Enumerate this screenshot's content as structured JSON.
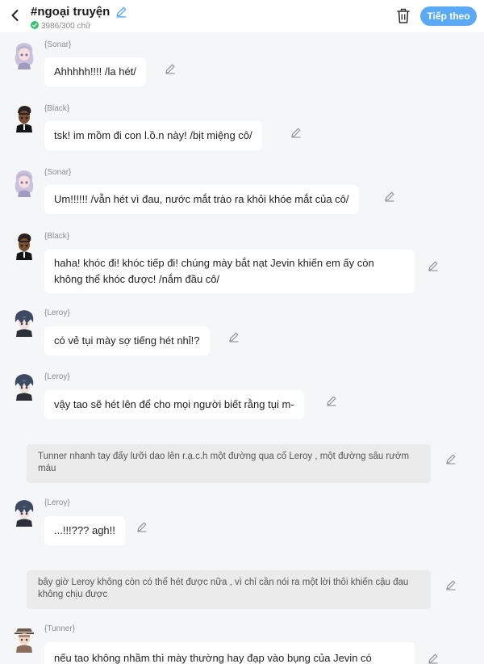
{
  "header": {
    "title": "#ngoại truyện",
    "count": "3986/300 chữ",
    "next_label": "Tiếp theo"
  },
  "colors": {
    "accent": "#5aa9f4",
    "check": "#34c26a",
    "background": "#f5f6f8"
  },
  "icons": [
    "back-arrow-icon",
    "pencil-icon",
    "check-icon",
    "trash-icon",
    "avatar-icon"
  ],
  "messages": [
    {
      "speaker": "{Sonar}",
      "text": "Ahhhhh!!!! /la hét/"
    },
    {
      "speaker": "{Black}",
      "text": "tsk! im mồm đi con l.ồ.n này! /bịt miệng cô/"
    },
    {
      "speaker": "{Sonar}",
      "text": "Um!!!!!! /vẫn hét vì đau, nước mắt trào ra khỏi khóe mắt của cô/"
    },
    {
      "speaker": "{Black}",
      "text": "haha! khóc đi! khóc tiếp đi! chúng mày bắt nạt Jevin khiến em ấy còn không thể khóc được! /nắm đầu cô/"
    },
    {
      "speaker": "{Leroy}",
      "text": "có vẻ tụi mày sợ tiếng hét nhỉ!?"
    },
    {
      "speaker": "{Leroy}",
      "text": "vậy tao sẽ hét lên để cho mọi người biết rằng tụi m-"
    },
    {
      "narration": "Tunner nhanh tay đẩy lưỡi dao lên r.ạ.c.h một đường qua cổ Leroy , một đường sâu rướm máu"
    },
    {
      "speaker": "{Leroy}",
      "text": "...!!!??? agh!!"
    },
    {
      "narration": "bây giờ Leroy không còn có thể hét được nữa , vì chỉ cần nói ra một lời thôi khiến cậu đau không chịu được"
    },
    {
      "speaker": "{Tunner}",
      "text": "nếu tao không nhầm thì mày thường hay đạp vào bụng của Jevin có"
    }
  ]
}
